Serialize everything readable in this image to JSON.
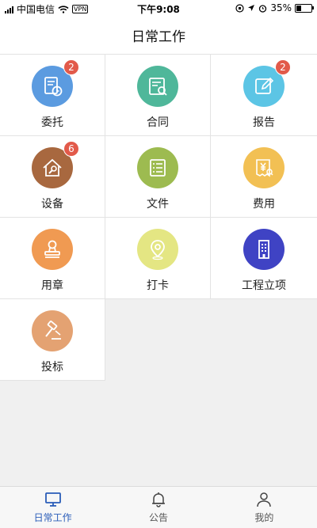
{
  "status_bar": {
    "carrier": "中国电信",
    "vpn": "VPN",
    "time": "下午9:08",
    "battery_pct": "35%",
    "battery_level": 0.35
  },
  "nav": {
    "title": "日常工作"
  },
  "colors": {
    "badge": "#e25a4a",
    "active_tab": "#2a5cb8",
    "weituo": "#5b9be0",
    "hetong": "#4fb79a",
    "baogao": "#5cc5e5",
    "shebei": "#a8683f",
    "wenjian": "#9dbb50",
    "feiyong": "#f2c054",
    "yongzhang": "#f09a52",
    "daka": "#e4e683",
    "gongcheng": "#3f43c4",
    "toubiao": "#e4a272"
  },
  "grid": {
    "items": [
      {
        "label": "委托",
        "icon": "document-clock-icon",
        "badge": "2"
      },
      {
        "label": "合同",
        "icon": "contract-search-icon",
        "badge": ""
      },
      {
        "label": "报告",
        "icon": "edit-report-icon",
        "badge": "2"
      },
      {
        "label": "设备",
        "icon": "house-wrench-icon",
        "badge": "6"
      },
      {
        "label": "文件",
        "icon": "file-list-icon",
        "badge": ""
      },
      {
        "label": "费用",
        "icon": "yen-receipt-icon",
        "badge": ""
      },
      {
        "label": "用章",
        "icon": "stamp-icon",
        "badge": ""
      },
      {
        "label": "打卡",
        "icon": "location-pin-icon",
        "badge": ""
      },
      {
        "label": "工程立项",
        "icon": "building-icon",
        "badge": ""
      },
      {
        "label": "投标",
        "icon": "gavel-icon",
        "badge": ""
      }
    ]
  },
  "tab_bar": {
    "tabs": [
      {
        "label": "日常工作",
        "icon": "monitor-icon",
        "active": true
      },
      {
        "label": "公告",
        "icon": "bell-icon",
        "active": false
      },
      {
        "label": "我的",
        "icon": "user-icon",
        "active": false
      }
    ]
  }
}
